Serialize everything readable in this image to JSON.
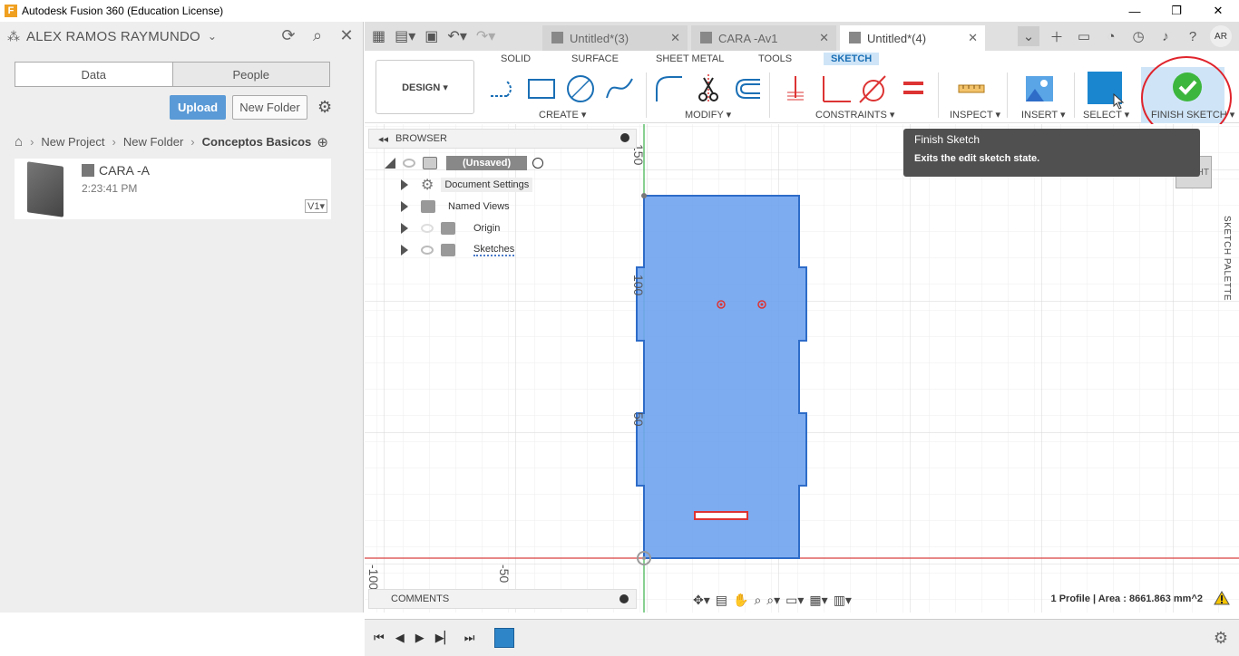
{
  "window": {
    "title": "Autodesk Fusion 360 (Education License)",
    "logo": "F"
  },
  "datapanel": {
    "user": "ALEX RAMOS RAYMUNDO",
    "tabs": [
      "Data",
      "People"
    ],
    "upload_label": "Upload",
    "new_folder_label": "New Folder",
    "breadcrumb": [
      "New Project",
      "New Folder",
      "Conceptos Basicos"
    ],
    "file": {
      "name": "CARA -A",
      "time": "2:23:41 PM",
      "version": "V1▾"
    }
  },
  "doc_tabs": [
    {
      "label": "Untitled*(3)",
      "active": false
    },
    {
      "label": "CARA -Av1",
      "active": false
    },
    {
      "label": "Untitled*(4)",
      "active": true
    }
  ],
  "profile_avatar": "AR",
  "toolbar": {
    "design_label": "DESIGN ▾",
    "workspace_tabs": [
      "SOLID",
      "SURFACE",
      "SHEET METAL",
      "TOOLS",
      "SKETCH"
    ],
    "active_workspace": "SKETCH",
    "groups": [
      "CREATE ▾",
      "MODIFY ▾",
      "CONSTRAINTS ▾",
      "INSPECT ▾",
      "INSERT ▾",
      "SELECT ▾",
      "FINISH SKETCH ▾"
    ]
  },
  "browser": {
    "title": "BROWSER",
    "root": "(Unsaved)",
    "items": [
      "Document Settings",
      "Named Views",
      "Origin",
      "Sketches"
    ]
  },
  "tooltip": {
    "title": "Finish Sketch",
    "description": "Exits the edit sketch state."
  },
  "canvas": {
    "ruler_labels_vertical": [
      "150",
      "100",
      "50"
    ],
    "ruler_labels_horizontal": [
      "-100",
      "-50"
    ],
    "sketch_palette_label": "SKETCH PALETTE",
    "viewcube_label": "HT"
  },
  "comments_label": "COMMENTS",
  "status": {
    "profile_info": "1 Profile | Area : 8661.863 mm^2"
  },
  "colors": {
    "sketch_fill": "#6fa3f0",
    "sketch_stroke": "#2e6cc8",
    "accent": "#1a6fb5",
    "finish_green": "#3db63d",
    "highlight_red": "#e0242c"
  }
}
